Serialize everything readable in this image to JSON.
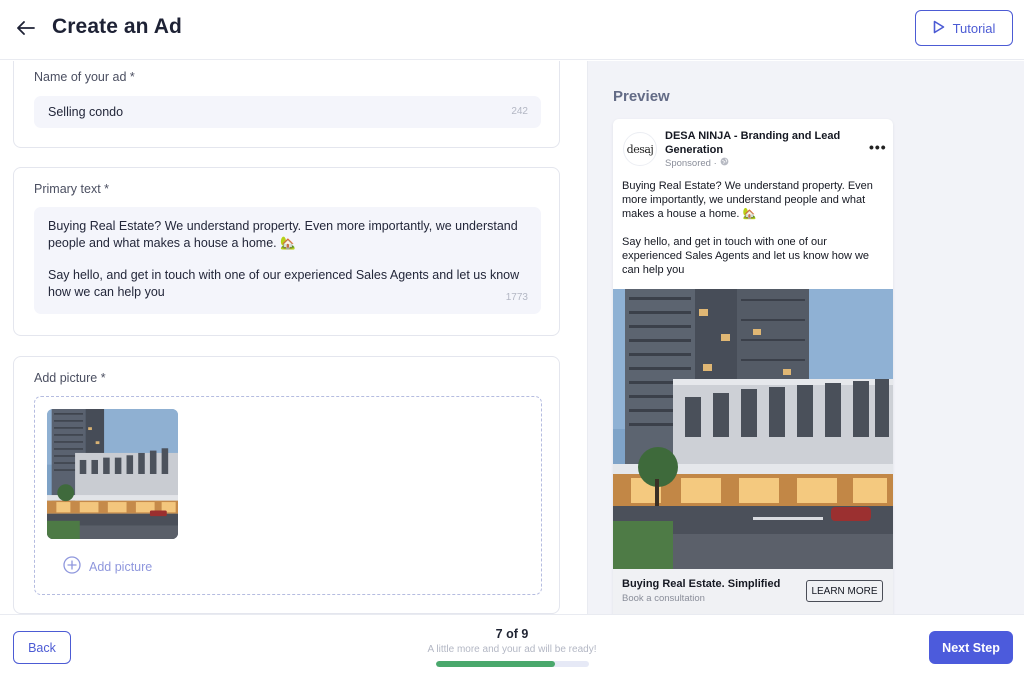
{
  "header": {
    "title": "Create an Ad",
    "tutorial_label": "Tutorial"
  },
  "form": {
    "name": {
      "label": "Name of your ad *",
      "value": "Selling condo",
      "counter": "242"
    },
    "primary_text": {
      "label": "Primary text *",
      "line1": "Buying Real Estate? We understand property. Even more importantly, we understand",
      "line2": "people and what makes a house a home. 🏡",
      "line3": "Say hello, and get in touch with one of our experienced Sales Agents and let us know",
      "line4": "how we can help you",
      "counter": "1773"
    },
    "picture": {
      "label": "Add picture *",
      "add_label": "Add picture"
    }
  },
  "preview": {
    "title": "Preview",
    "logo_text": "desaj",
    "page_name": "DESA NINJA - Branding and Lead Generation",
    "sponsored": "Sponsored ·",
    "more": "•••",
    "body": "Buying Real Estate? We understand property. Even more importantly, we understand people and what makes a house a home. 🏡\n\nSay hello, and get in touch with one of our experienced Sales Agents and let us know how we can help you",
    "headline": "Buying Real Estate. Simplified",
    "description": "Book a consultation",
    "cta": "LEARN MORE"
  },
  "footer": {
    "back_label": "Back",
    "step": "7 of 9",
    "hint": "A little more and your ad will be ready!",
    "progress": 0.78,
    "next_label": "Next Step"
  },
  "icons": {
    "back": "arrow-left-icon",
    "tutorial": "play-icon",
    "add": "plus-circle-icon",
    "globe": "globe-icon"
  },
  "colors": {
    "accent": "#4c5bd4",
    "progress": "#4aa86c",
    "preview_bg": "#f2f3f8"
  }
}
